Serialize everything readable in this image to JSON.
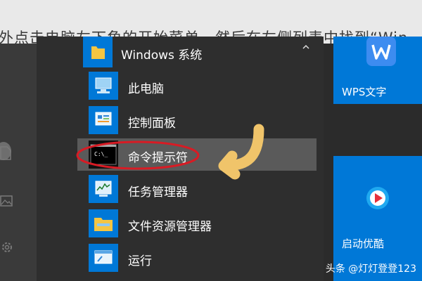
{
  "article_text": "外点击电脑左下角的开始菜单，然后在左侧列表中找到“Win",
  "group": {
    "label": "Windows 系统"
  },
  "items": [
    {
      "label": "此电脑",
      "icon": "computer-icon"
    },
    {
      "label": "控制面板",
      "icon": "control-panel-icon"
    },
    {
      "label": "命令提示符",
      "icon": "command-prompt-icon",
      "highlighted": true
    },
    {
      "label": "任务管理器",
      "icon": "task-manager-icon"
    },
    {
      "label": "文件资源管理器",
      "icon": "file-explorer-icon"
    },
    {
      "label": "运行",
      "icon": "run-icon"
    }
  ],
  "tiles": [
    {
      "label": "WPS文字",
      "icon": "wps-writer-icon"
    },
    {
      "label": "启动优酷",
      "icon": "youku-icon"
    }
  ],
  "watermark": "头条 @灯灯登登123",
  "colors": {
    "accent": "#0078d7",
    "annotation": "#d81b24",
    "arrow": "#f0c46a"
  }
}
